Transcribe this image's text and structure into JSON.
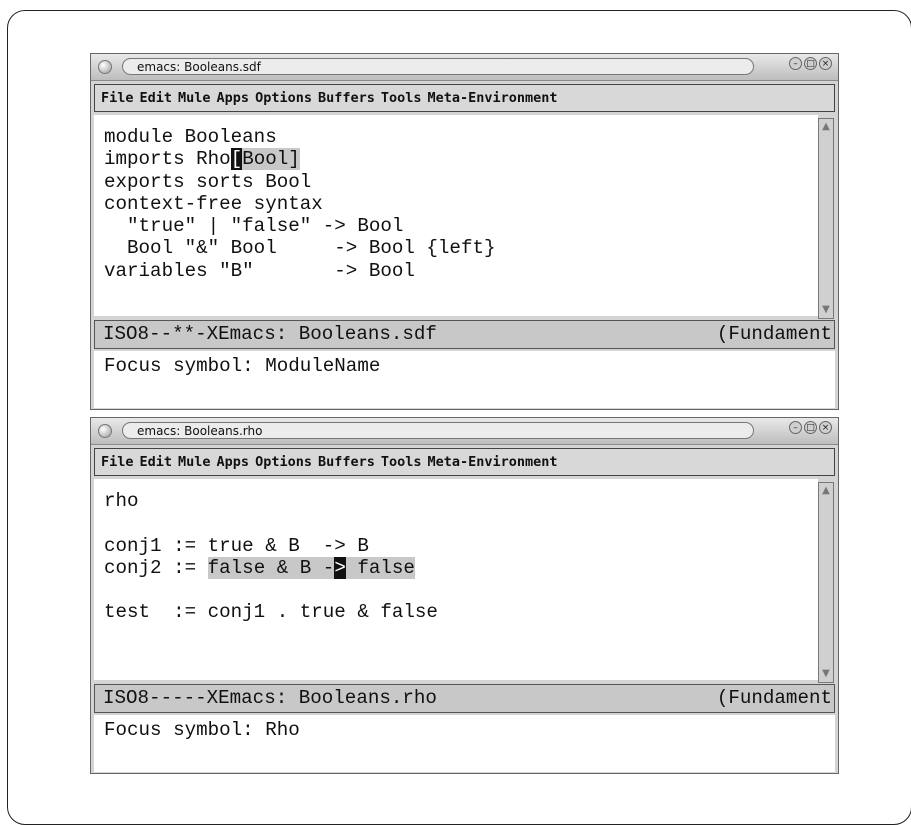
{
  "windows": [
    {
      "title": "emacs: Booleans.sdf",
      "menu": [
        "File",
        "Edit",
        "Mule",
        "Apps",
        "Options",
        "Buffers",
        "Tools",
        "Meta-Environment"
      ],
      "lines": [
        [
          {
            "t": "module Booleans"
          }
        ],
        [
          {
            "t": "imports Rho"
          },
          {
            "t": "[",
            "style": "cursor"
          },
          {
            "t": "Bool]",
            "style": "hl"
          }
        ],
        [
          {
            "t": "exports sorts Bool"
          }
        ],
        [
          {
            "t": "context-free syntax"
          }
        ],
        [
          {
            "t": "  \"true\" | \"false\" -> Bool"
          }
        ],
        [
          {
            "t": "  Bool \"&\" Bool     -> Bool {left}"
          }
        ],
        [
          {
            "t": "variables \"B\"       -> Bool"
          }
        ]
      ],
      "modeline_left": "ISO8--**-XEmacs: Booleans.sdf",
      "modeline_right": "(Fundament",
      "echo": "Focus symbol: ModuleName"
    },
    {
      "title": "emacs: Booleans.rho",
      "menu": [
        "File",
        "Edit",
        "Mule",
        "Apps",
        "Options",
        "Buffers",
        "Tools",
        "Meta-Environment"
      ],
      "lines": [
        [
          {
            "t": "rho"
          }
        ],
        [
          {
            "t": ""
          }
        ],
        [
          {
            "t": "conj1 := true & B  -> B"
          }
        ],
        [
          {
            "t": "conj2 := "
          },
          {
            "t": "false & B -",
            "style": "hl"
          },
          {
            "t": ">",
            "style": "cursor"
          },
          {
            "t": " false",
            "style": "hl"
          }
        ],
        [
          {
            "t": ""
          }
        ],
        [
          {
            "t": "test  := conj1 . true & false"
          }
        ]
      ],
      "modeline_left": "ISO8-----XEmacs: Booleans.rho",
      "modeline_right": "(Fundament",
      "echo": "Focus symbol: Rho"
    }
  ],
  "icons": {
    "window_menu": "window-menu-icon",
    "minimize": "minimize-icon",
    "maximize": "maximize-icon",
    "close": "close-icon",
    "scroll_up": "scroll-up-arrow-icon",
    "scroll_down": "scroll-down-arrow-icon"
  },
  "colors": {
    "region_highlight": "#c8c8c8",
    "cursor": "#111111",
    "modeline_bg": "#c8c8c8",
    "editor_bg": "#ffffff"
  }
}
